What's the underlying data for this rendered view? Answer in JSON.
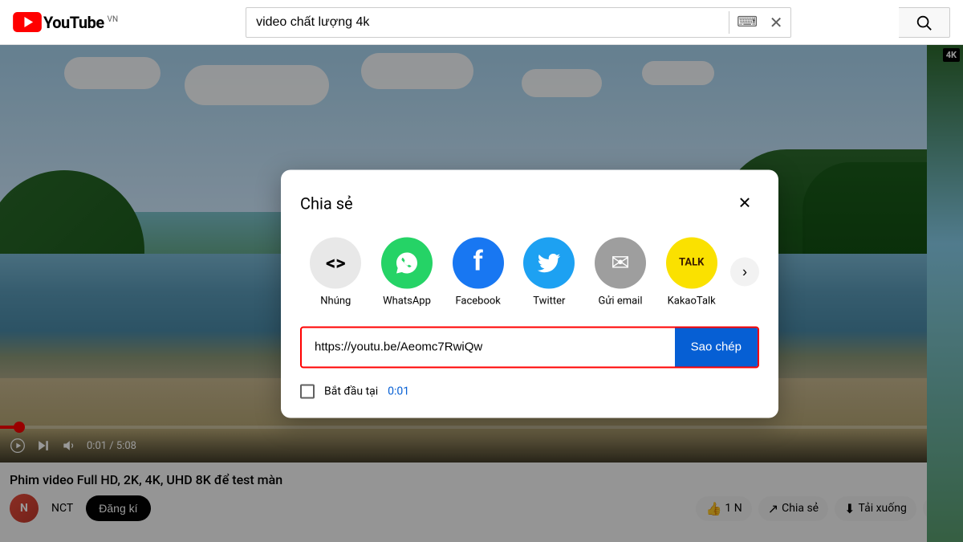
{
  "header": {
    "logo_text": "YouTube",
    "country_code": "VN",
    "search_query": "video chất lượng 4k"
  },
  "video": {
    "title": "Phim video Full HD, 2K, 4K, UHD 8K để test màn",
    "channel": "NCT",
    "time_current": "0:01",
    "time_total": "5:08",
    "progress_percent": 2,
    "subscribe_label": "Đăng kí"
  },
  "action_bar": {
    "like_label": "1 N",
    "share_label": "Chia sẻ",
    "download_label": "Tải xuống"
  },
  "share_modal": {
    "title": "Chia sẻ",
    "close_icon": "✕",
    "share_items": [
      {
        "id": "embed",
        "label": "Nhúng",
        "icon": "<>",
        "color": "#e8e8e8"
      },
      {
        "id": "whatsapp",
        "label": "WhatsApp",
        "icon": "W",
        "color": "#25D366"
      },
      {
        "id": "facebook",
        "label": "Facebook",
        "icon": "f",
        "color": "#1877F2"
      },
      {
        "id": "twitter",
        "label": "Twitter",
        "icon": "t",
        "color": "#1DA1F2"
      },
      {
        "id": "email",
        "label": "Gửi email",
        "icon": "✉",
        "color": "#9e9e9e"
      },
      {
        "id": "kakao",
        "label": "KakaoTalk",
        "icon": "TALK",
        "color": "#FAE100"
      }
    ],
    "url": "https://youtu.be/Aeomc7RwiQw",
    "copy_label": "Sao chép",
    "start_time_label": "Bắt đầu tại",
    "start_time_value": "0:01",
    "chevron_icon": "›"
  },
  "k4_badge": "4K"
}
